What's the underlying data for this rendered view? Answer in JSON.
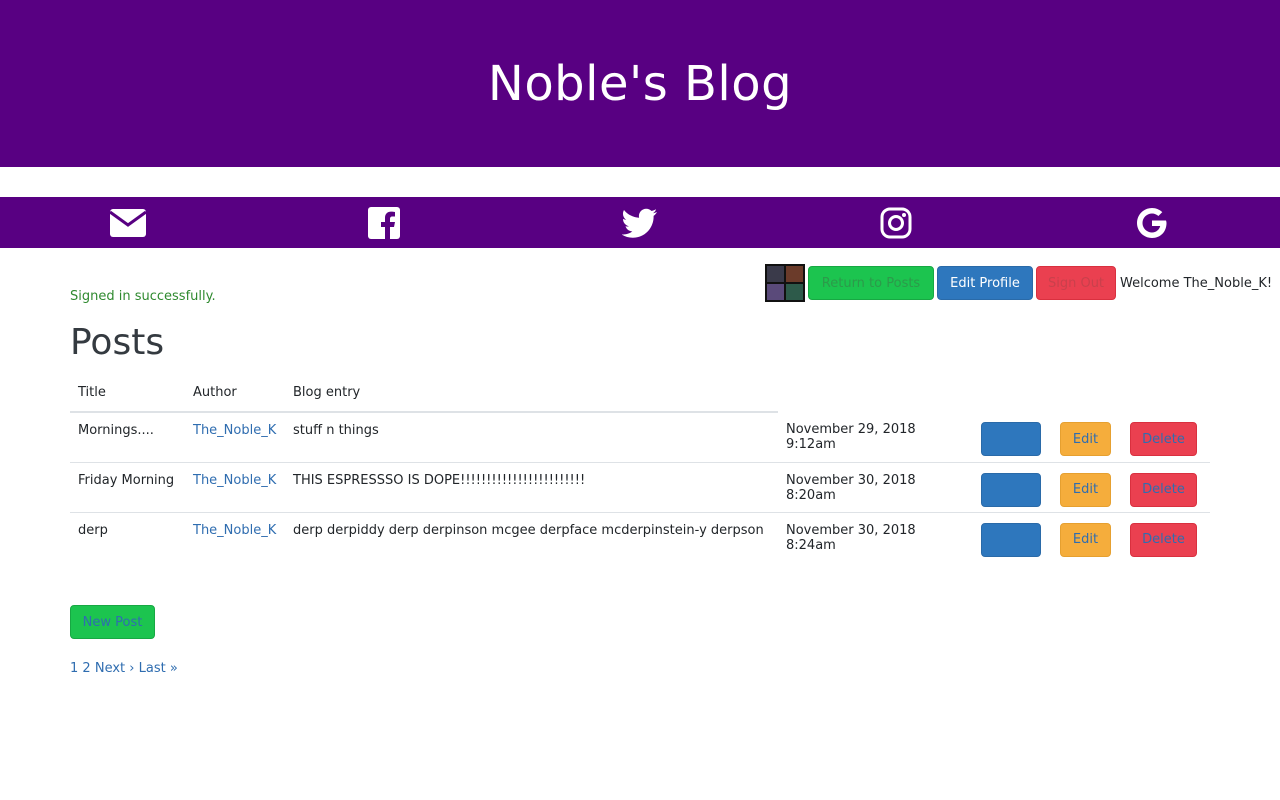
{
  "header": {
    "title": "Noble's Blog"
  },
  "social": [
    {
      "icon": "envelope-icon"
    },
    {
      "icon": "facebook-icon"
    },
    {
      "icon": "twitter-icon"
    },
    {
      "icon": "instagram-icon"
    },
    {
      "icon": "google-icon"
    }
  ],
  "colors": {
    "brand": "#580082",
    "success": "#1cc44f",
    "primary": "#2e77bd",
    "danger": "#ea4050",
    "warning": "#f5ad3c",
    "link": "#2f6db0"
  },
  "flash": {
    "notice": "Signed in successfully."
  },
  "userbar": {
    "return_label": "Return to Posts",
    "edit_profile_label": "Edit Profile",
    "sign_out_label": "Sign Out",
    "welcome": "Welcome The_Noble_K!"
  },
  "main": {
    "heading": "Posts",
    "columns": [
      "Title",
      "Author",
      "Blog entry"
    ],
    "rows": [
      {
        "title": "Mornings....",
        "author": "The_Noble_K",
        "entry": "stuff n things",
        "date": "November 29, 2018 9:12am",
        "show": "",
        "edit": "Edit",
        "delete": "Delete"
      },
      {
        "title": "Friday Morning",
        "author": "The_Noble_K",
        "entry": "THIS ESPRESSSO IS DOPE!!!!!!!!!!!!!!!!!!!!!!!!",
        "date": "November 30, 2018 8:20am",
        "show": "",
        "edit": "Edit",
        "delete": "Delete"
      },
      {
        "title": "derp",
        "author": "The_Noble_K",
        "entry": "derp derpiddy derp derpinson mcgee derpface mcderpinstein-y derpson",
        "date": "November 30, 2018 8:24am",
        "show": "",
        "edit": "Edit",
        "delete": "Delete"
      }
    ],
    "new_post_label": "New Post"
  },
  "pagination": {
    "current": "1",
    "page2": "2",
    "next": "Next ›",
    "last": "Last »"
  }
}
